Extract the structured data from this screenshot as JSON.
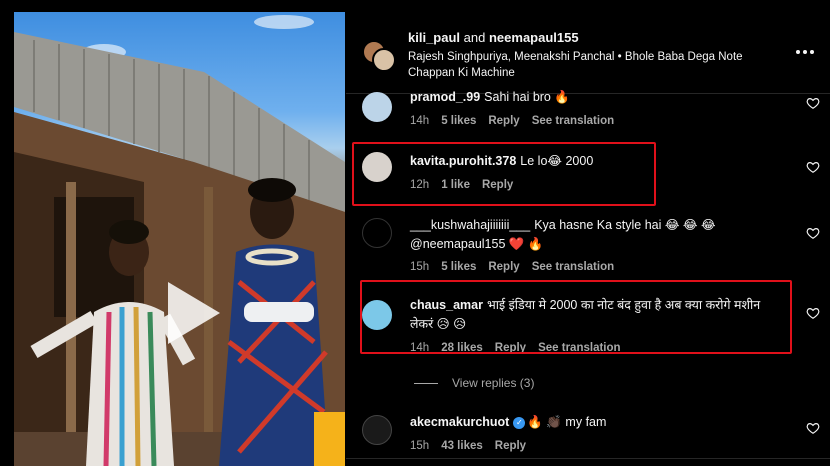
{
  "header": {
    "author_1": "kili_paul",
    "and_text": "and",
    "author_2": "neemapaul155",
    "audio": "Rajesh Singhpuriya, Meenakshi Panchal • Bhole Baba Dega Note Chappan Ki Machine"
  },
  "comments": [
    {
      "username": "pramod_.99",
      "text": "Sahi hai bro 🔥",
      "time": "14h",
      "likes": "5 likes",
      "reply": "Reply",
      "translation": "See translation"
    },
    {
      "username": "kavita.purohit.378",
      "text": "Le lo😂 2000",
      "time": "12h",
      "likes": "1 like",
      "reply": "Reply"
    },
    {
      "username": "___kushwahajiiiiiii___",
      "text": "Kya hasne Ka style hai 😂 😂 😂 @neemapaul155 ❤️ 🔥",
      "time": "15h",
      "likes": "5 likes",
      "reply": "Reply",
      "translation": "See translation"
    },
    {
      "username": "chaus_amar",
      "text": "भाई इंडिया मे 2000 का नोट बंद हुवा है अब क्या करोगे मशीन लेकरं 😥 😥",
      "time": "14h",
      "likes": "28 likes",
      "reply": "Reply",
      "translation": "See translation"
    },
    {
      "username": "akecmakurchuot",
      "text": "🔥 👏🏿 my fam",
      "time": "15h",
      "likes": "43 likes",
      "reply": "Reply"
    }
  ],
  "view_replies": "View replies (3)",
  "colors": {
    "highlight": "#e0101a",
    "muted": "#a8a8a8",
    "verified": "#3897f0"
  },
  "icons": [
    "more-icon",
    "heart-icon",
    "play-icon",
    "verified-icon"
  ]
}
